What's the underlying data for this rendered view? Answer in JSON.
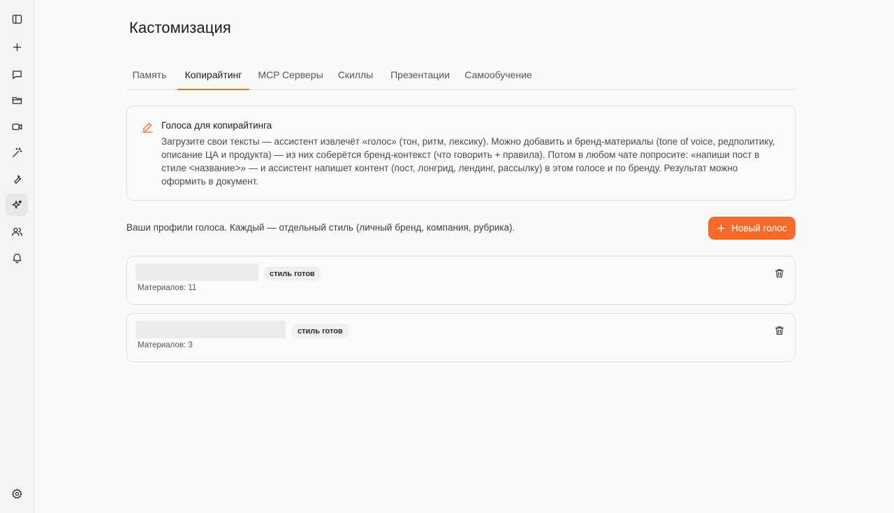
{
  "sidebar": {
    "items": [
      {
        "icon": "sidebar-toggle-icon"
      },
      {
        "icon": "plus-icon"
      },
      {
        "icon": "chat-icon"
      },
      {
        "icon": "folder-icon"
      },
      {
        "icon": "video-icon"
      },
      {
        "icon": "magic-wand-icon"
      },
      {
        "icon": "wrench-icon"
      },
      {
        "icon": "sparkles-icon",
        "active": true
      },
      {
        "icon": "users-icon"
      },
      {
        "icon": "bell-icon"
      }
    ],
    "bottom": {
      "icon": "gear-icon"
    }
  },
  "page": {
    "title": "Кастомизация"
  },
  "tabs": [
    {
      "label": "Память"
    },
    {
      "label": "Копирайтинг",
      "active": true
    },
    {
      "label": "MCP Серверы"
    },
    {
      "label": "Скиллы"
    },
    {
      "label": "Презентации"
    },
    {
      "label": "Самообучение"
    }
  ],
  "info": {
    "title": "Голоса для копирайтинга",
    "text": "Загрузите свои тексты — ассистент извлечёт «голос» (тон, ритм, лексику). Можно добавить и бренд-материалы (tone of voice, редполитику, описание ЦА и продукта) — из них соберётся бренд-контекст (что говорить + правила). Потом в любом чате попросите: «напиши пост в стиле <название>» — и ассистент напишет контент (пост, лонгрид, лендинг, рассылку) в этом голосе и по бренду. Результат можно оформить в документ."
  },
  "profiles": {
    "caption": "Ваши профили голоса. Каждый — отдельный стиль (личный бренд, компания, рубрика).",
    "new_button": "Новый голос",
    "items": [
      {
        "status": "стиль готов",
        "materials": "Материалов: 11"
      },
      {
        "status": "стиль готов",
        "materials": "Материалов: 3"
      }
    ]
  },
  "colors": {
    "accent": "#f26b2a",
    "background": "#fafafa",
    "border": "#dedee1"
  }
}
